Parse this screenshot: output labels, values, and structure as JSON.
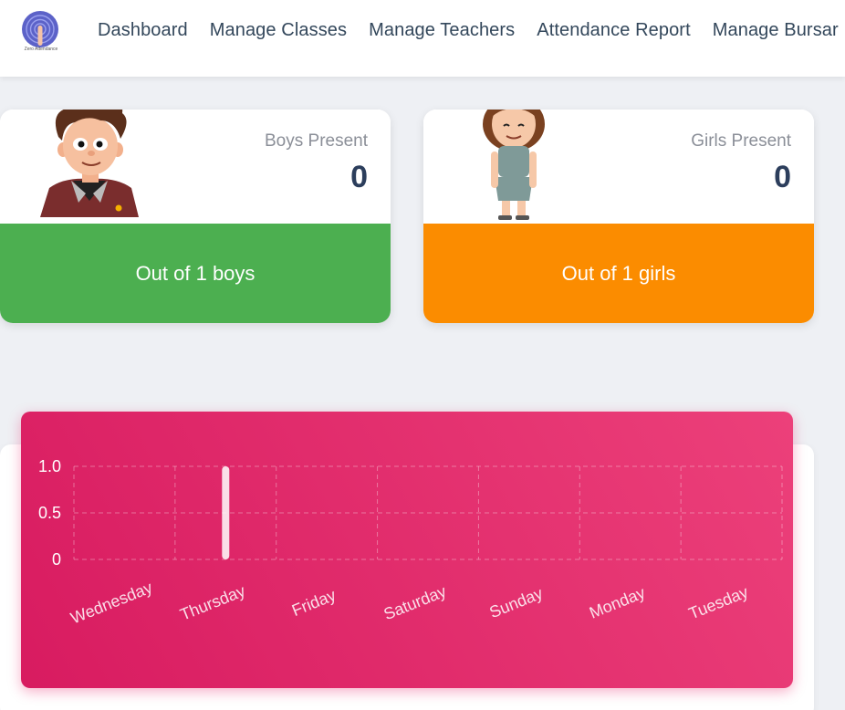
{
  "nav": {
    "logo_text": "Zero Attendance",
    "items": [
      "Dashboard",
      "Manage Classes",
      "Manage Teachers",
      "Attendance Report",
      "Manage Bursar"
    ]
  },
  "boys_card": {
    "label": "Boys Present",
    "count": "0",
    "footer": "Out of 1 boys",
    "color": "#4caf50"
  },
  "girls_card": {
    "label": "Girls Present",
    "count": "0",
    "footer": "Out of 1 girls",
    "color": "#fb8c00"
  },
  "chart_data": {
    "type": "bar",
    "categories": [
      "Wednesday",
      "Thursday",
      "Friday",
      "Saturday",
      "Sunday",
      "Monday",
      "Tuesday"
    ],
    "values": [
      0,
      1,
      0,
      0,
      0,
      0,
      0
    ],
    "ylim": [
      0,
      1
    ],
    "yticks": [
      "0",
      "0.5",
      "1.0"
    ],
    "grid": true,
    "background": "#e91e63"
  }
}
